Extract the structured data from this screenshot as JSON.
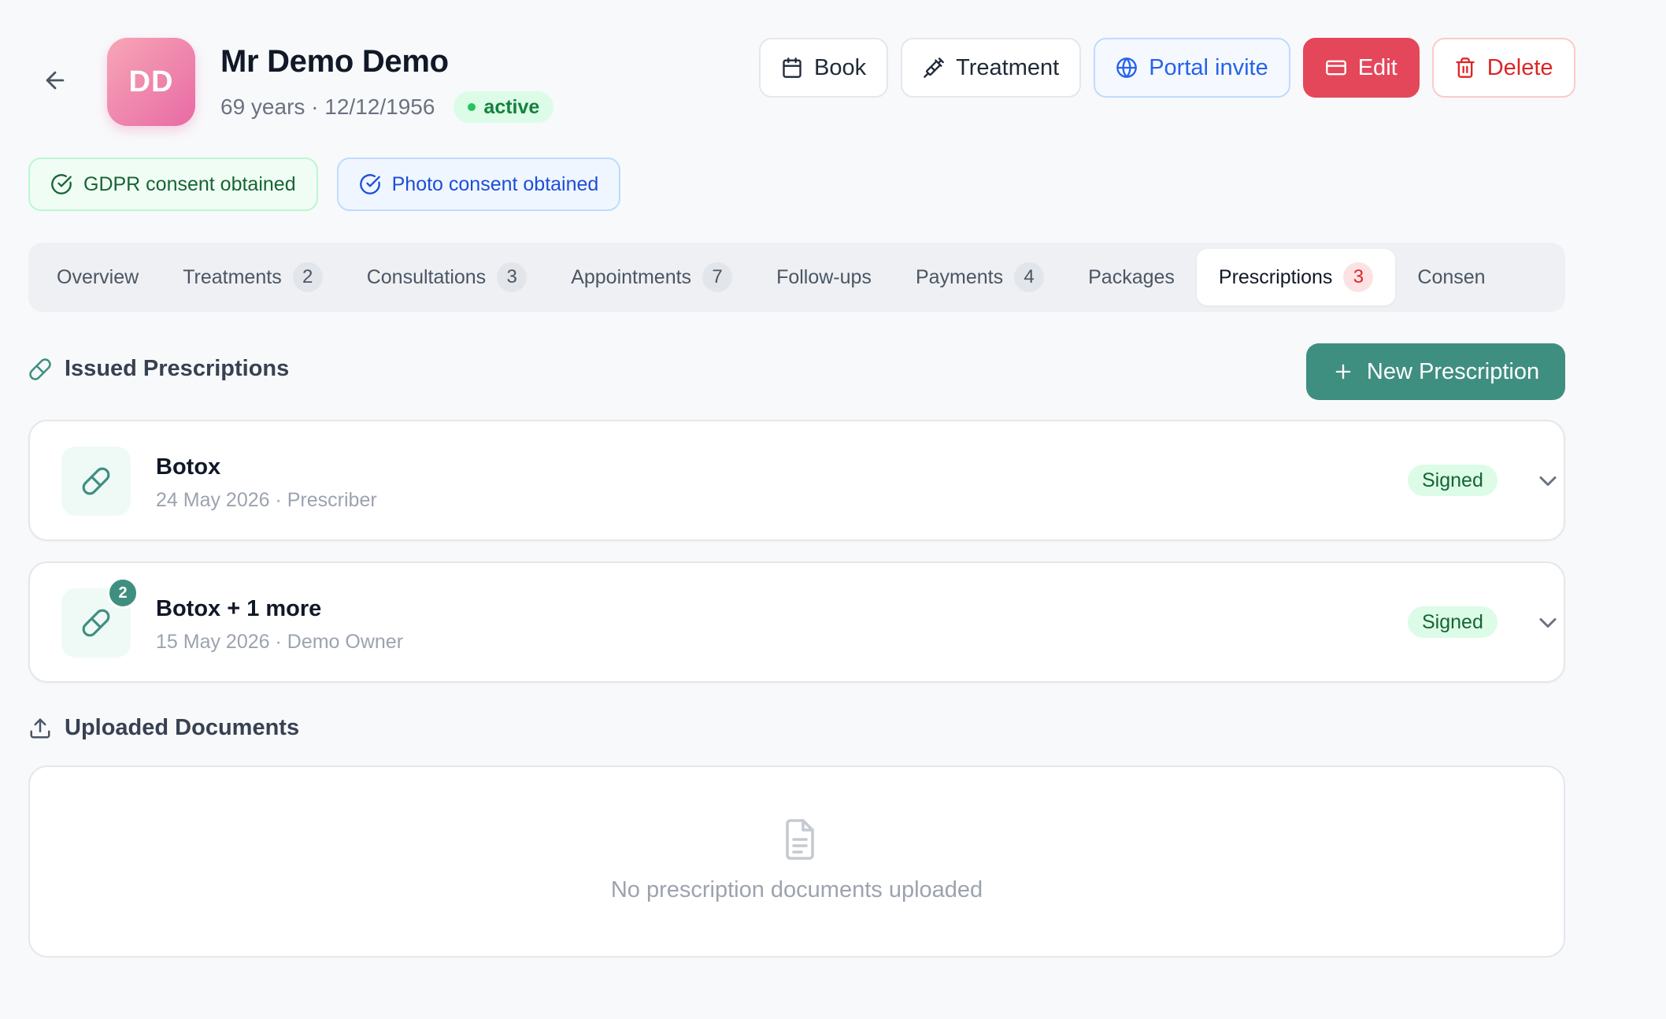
{
  "patient": {
    "initials": "DD",
    "name": "Mr Demo Demo",
    "age": "69 years",
    "dob": "12/12/1956",
    "meta": "69 years · 12/12/1956",
    "status": "active"
  },
  "actions": {
    "book": "Book",
    "treatment": "Treatment",
    "portal_invite": "Portal invite",
    "edit": "Edit",
    "delete": "Delete"
  },
  "consents": {
    "gdpr": "GDPR consent obtained",
    "photo": "Photo consent obtained"
  },
  "tabs": [
    {
      "label": "Overview",
      "count": ""
    },
    {
      "label": "Treatments",
      "count": "2"
    },
    {
      "label": "Consultations",
      "count": "3"
    },
    {
      "label": "Appointments",
      "count": "7"
    },
    {
      "label": "Follow-ups",
      "count": ""
    },
    {
      "label": "Payments",
      "count": "4"
    },
    {
      "label": "Packages",
      "count": ""
    },
    {
      "label": "Prescriptions",
      "count": "3"
    },
    {
      "label": "Consen",
      "count": ""
    }
  ],
  "prescriptions": {
    "section_title": "Issued Prescriptions",
    "new_button": "New Prescription",
    "items": [
      {
        "title": "Botox",
        "subtitle": "24 May 2026 · Prescriber",
        "status": "Signed",
        "count": ""
      },
      {
        "title": "Botox + 1 more",
        "subtitle": "15 May 2026 · Demo Owner",
        "status": "Signed",
        "count": "2"
      }
    ]
  },
  "documents": {
    "section_title": "Uploaded Documents",
    "empty_text": "No prescription documents uploaded"
  },
  "colors": {
    "accent": "#3f8f81",
    "edit": "#e5475a",
    "delete": "#dc2626",
    "portal": "#2563eb",
    "active_status": "#15803d"
  }
}
